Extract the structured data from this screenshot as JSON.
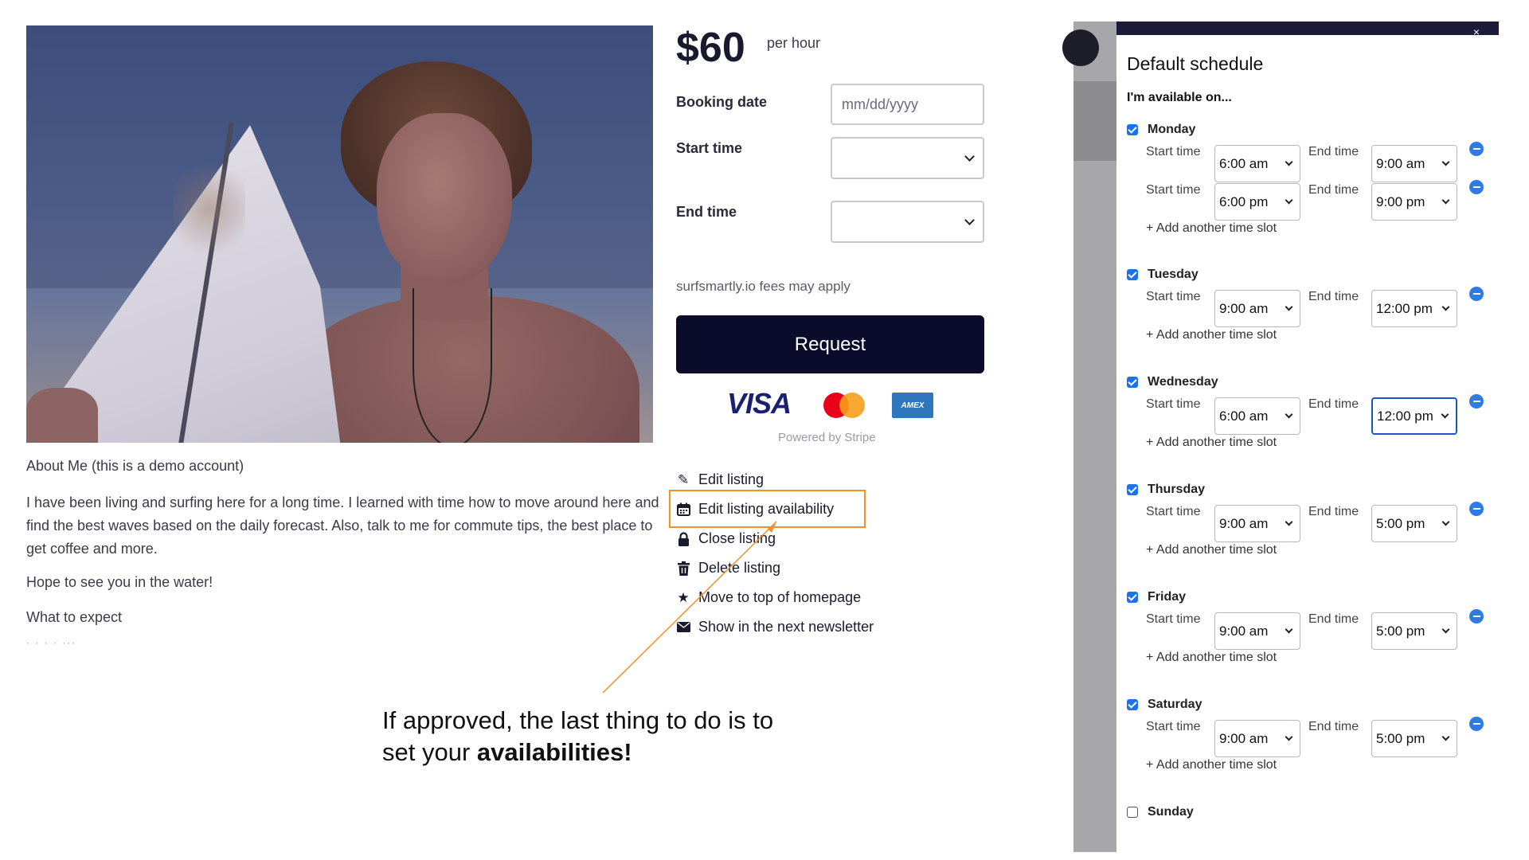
{
  "listing": {
    "about_heading": "About Me (this is a demo account)",
    "about_body": "I have been living and surfing here for a long time. I learned with time how to move around here and find the best waves based on the daily forecast. Also, talk to me for commute tips, the best place to get coffee and more.",
    "hope": "Hope to see you in the water!",
    "expect": "What to expect",
    "expect_cont": "· · ·  · ···"
  },
  "booking": {
    "price": "$60",
    "price_unit": "per hour",
    "date_label": "Booking date",
    "date_placeholder": "mm/dd/yyyy",
    "start_label": "Start time",
    "end_label": "End time",
    "fees_note": "surfsmartly.io fees may apply",
    "request_label": "Request",
    "cards": {
      "visa": "VISA",
      "amex": "AMEX"
    },
    "powered_by": "Powered by Stripe"
  },
  "actions": [
    {
      "label": "Edit listing",
      "icon": "pencil-icon"
    },
    {
      "label": "Edit listing availability",
      "icon": "calendar-icon"
    },
    {
      "label": "Close listing",
      "icon": "lock-icon"
    },
    {
      "label": "Delete listing",
      "icon": "trash-icon"
    },
    {
      "label": "Move to top of homepage",
      "icon": "star-icon"
    },
    {
      "label": "Show in the next newsletter",
      "icon": "envelope-icon"
    }
  ],
  "callout": {
    "line1": "If approved, the last thing to do is to",
    "line2_prefix": "set your ",
    "line2_bold": "availabilities!"
  },
  "schedule": {
    "close": "×",
    "title": "Default schedule",
    "subtitle": "I'm available on...",
    "start_label": "Start time",
    "end_label": "End time",
    "add_slot": "+ Add another time slot",
    "days": [
      {
        "name": "Monday",
        "checked": true,
        "slots": [
          {
            "start": "6:00 am",
            "end": "9:00 am"
          },
          {
            "start": "6:00 pm",
            "end": "9:00 pm"
          }
        ]
      },
      {
        "name": "Tuesday",
        "checked": true,
        "slots": [
          {
            "start": "9:00 am",
            "end": "12:00 pm"
          }
        ]
      },
      {
        "name": "Wednesday",
        "checked": true,
        "slots": [
          {
            "start": "6:00 am",
            "end": "12:00 pm"
          }
        ]
      },
      {
        "name": "Thursday",
        "checked": true,
        "slots": [
          {
            "start": "9:00 am",
            "end": "5:00 pm"
          }
        ]
      },
      {
        "name": "Friday",
        "checked": true,
        "slots": [
          {
            "start": "9:00 am",
            "end": "5:00 pm"
          }
        ]
      },
      {
        "name": "Saturday",
        "checked": true,
        "slots": [
          {
            "start": "9:00 am",
            "end": "5:00 pm"
          }
        ]
      },
      {
        "name": "Sunday",
        "checked": false,
        "slots": []
      }
    ]
  },
  "colors": {
    "brand_dark": "#0b0b2b",
    "highlight": "#f5902a",
    "checkbox": "#1a73e8",
    "remove_button": "#2f7be5"
  }
}
